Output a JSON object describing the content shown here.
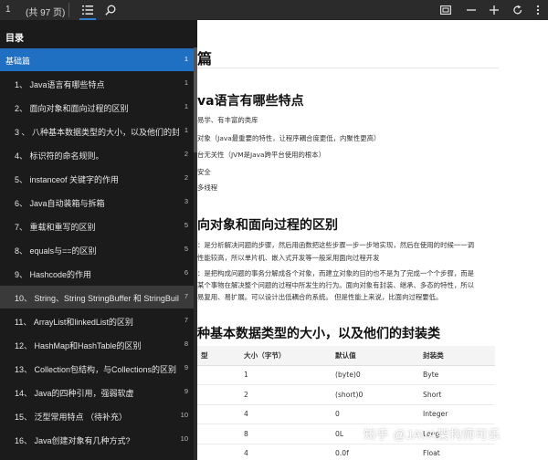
{
  "toolbar": {
    "page_number": "1",
    "total_pages": "(共 97 页)",
    "buttons": [
      {
        "icon": "list-icon",
        "active": true
      },
      {
        "icon": "search-icon",
        "active": false
      },
      {
        "icon": "fit-page-icon"
      },
      {
        "icon": "zoom-out-icon"
      },
      {
        "icon": "zoom-in-icon"
      },
      {
        "icon": "rotate-icon"
      },
      {
        "icon": "more-icon"
      }
    ],
    "accent_color": "#2f7fd0"
  },
  "toc": {
    "title": "目录",
    "section": {
      "label": "基础篇",
      "page": "1",
      "color": "#1f6fc2"
    },
    "items": [
      {
        "label": "1、 Java语言有哪些特点",
        "page": "1"
      },
      {
        "label": "2、 面向对象和面向过程的区别",
        "page": "1"
      },
      {
        "label": "3 、 八种基本数据类型的大小，以及他们的封装类",
        "page": "1"
      },
      {
        "label": "4、 标识符的命名规则。",
        "page": "2"
      },
      {
        "label": "5、 instanceof 关键字的作用",
        "page": "2"
      },
      {
        "label": "6、 Java自动装箱与拆箱",
        "page": "3"
      },
      {
        "label": "7、 重载和重写的区别",
        "page": "5"
      },
      {
        "label": "8、 equals与==的区别",
        "page": "5"
      },
      {
        "label": "9、 Hashcode的作用",
        "page": "6"
      },
      {
        "label": "10、 String、String StringBuffer 和 StringBuilder 的区别",
        "page": "7"
      },
      {
        "label": "11、 ArrayList和linkedList的区别",
        "page": "7"
      },
      {
        "label": "12、 HashMap和HashTable的区别",
        "page": "8"
      },
      {
        "label": "13、 Collection包结构，与Collections的区别",
        "page": "9"
      },
      {
        "label": "14、 Java的四种引用，强弱软虚",
        "page": "9"
      },
      {
        "label": "15、 泛型常用特点 （待补充）",
        "page": "10"
      },
      {
        "label": "16、 Java创建对象有几种方式?",
        "page": "10"
      }
    ],
    "selected_index": 9
  },
  "document": {
    "heading1": "篇",
    "section1_title": "va语言有哪些特点",
    "section1_lines": [
      "易学、有丰富的类库",
      "对象（Java最重要的特性，让程序耦合度更低，内聚性更高）",
      "台无关性（JVM是Java跨平台使用的根本）",
      "安全",
      "多线程"
    ],
    "section2_title": "向对象和面向过程的区别",
    "section2_lines": [
      "：是分析解决问题的步骤，然后用函数把这些步骤一步一步地实现，然后在使用的时候一一调",
      "性能较高，所以单片机、嵌入式开发等一般采用面向过程开发",
      "：是把构成问题的事务分解成各个对象，而建立对象的目的也不是为了完成一个个步骤，而是",
      "某个事物在解决整个问题的过程中所发生的行为。面向对象有封装、继承、多态的特性，所以",
      "易复用、易扩展。可以设计出低耦合的系统。 但是性能上来说，比面向过程要低。"
    ],
    "section3_title": "种基本数据类型的大小，以及他们的封装类",
    "table": {
      "headers": [
        "型",
        "大小（字节）",
        "默认值",
        "封装类"
      ],
      "rows": [
        [
          "",
          "1",
          "(byte)0",
          "Byte"
        ],
        [
          "",
          "2",
          "(short)0",
          "Short"
        ],
        [
          "",
          "4",
          "0",
          "Integer"
        ],
        [
          "",
          "8",
          "0L",
          "Long"
        ],
        [
          "",
          "4",
          "0.0f",
          "Float"
        ]
      ]
    }
  },
  "watermark": "知乎 @JAVA架构师可乐"
}
